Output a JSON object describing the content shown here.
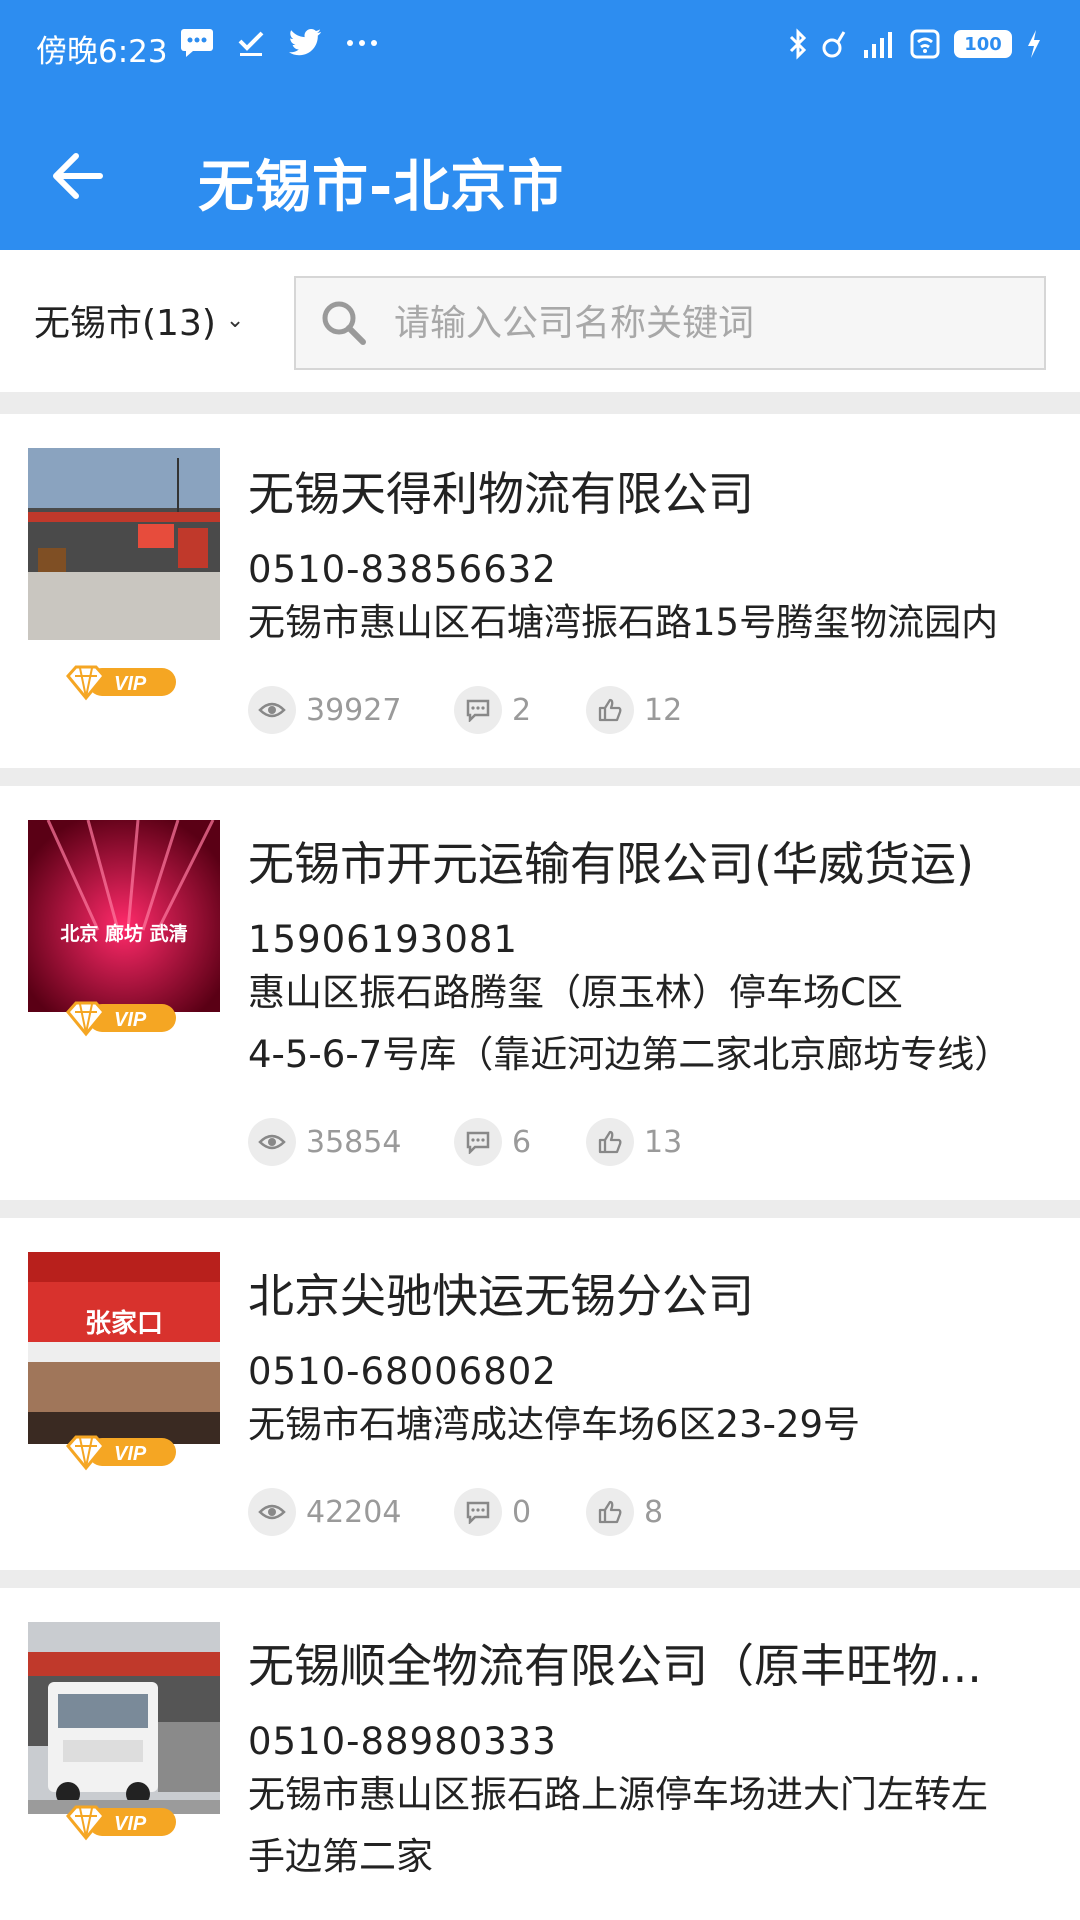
{
  "status": {
    "time": "傍晚6:23",
    "battery": "100"
  },
  "header": {
    "title": "无锡市-北京市"
  },
  "filter": {
    "city": "无锡市(13)",
    "search_placeholder": "请输入公司名称关键词"
  },
  "badge": {
    "vip": "VIP"
  },
  "companies": [
    {
      "name": "无锡天得利物流有限公司",
      "phone": "0510-83856632",
      "address_lines": [
        "无锡市惠山区石塘湾振石路15号腾玺物流园内"
      ],
      "views": "39927",
      "comments": "2",
      "likes": "12"
    },
    {
      "name": "无锡市开元运输有限公司(华威货运)",
      "phone": "15906193081",
      "address_lines": [
        "惠山区振石路腾玺（原玉林）停车场C区",
        "4-5-6-7号库（靠近河边第二家北京廊坊专线）"
      ],
      "views": "35854",
      "comments": "6",
      "likes": "13",
      "photo_text": "北京 廊坊 武清"
    },
    {
      "name": "北京尖驰快运无锡分公司",
      "phone": "0510-68006802",
      "address_lines": [
        "无锡市石塘湾成达停车场6区23-29号"
      ],
      "views": "42204",
      "comments": "0",
      "likes": "8",
      "photo_text": "张家口"
    },
    {
      "name": "无锡顺全物流有限公司（原丰旺物...",
      "phone": "0510-88980333",
      "address_lines": [
        "无锡市惠山区振石路上源停车场进大门左转左",
        "手边第二家"
      ]
    }
  ],
  "colors": {
    "primary": "#2d8df0",
    "vip_gold": "#f5a623",
    "muted": "#9a9a9a"
  }
}
